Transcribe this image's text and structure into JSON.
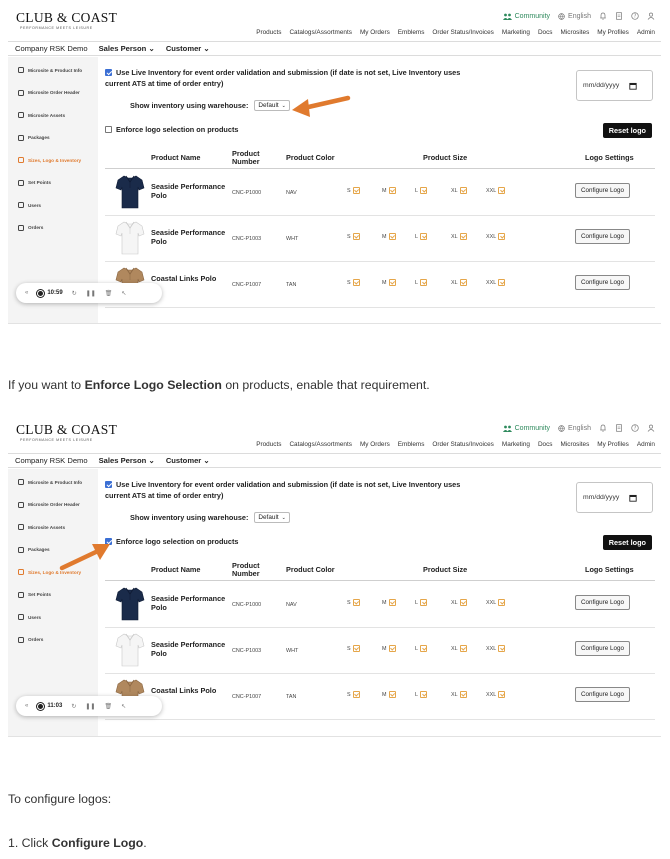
{
  "colors": {
    "accent": "#e07a2e",
    "community": "#2e8a5d",
    "checkbox": "#3b6fd4",
    "size_check": "#e5a64a"
  },
  "header": {
    "brand": "CLUB & COAST",
    "tagline": "PERFORMANCE MEETS LEISURE",
    "community": "Community",
    "language": "English",
    "icons": [
      "community-icon",
      "globe-icon",
      "bell-icon",
      "document-icon",
      "help-icon",
      "user-icon"
    ],
    "nav": [
      "Products",
      "Catalogs/Assortments",
      "My Orders",
      "Emblems",
      "Order Status/Invoices",
      "Marketing",
      "Docs",
      "Microsites",
      "My Profiles",
      "Admin"
    ]
  },
  "context": {
    "company_label": "Company",
    "company_value": "RSK Demo",
    "sales_person": "Sales Person",
    "customer": "Customer"
  },
  "sidebar": [
    {
      "label": "Microsite & Product Info",
      "icon": "info-icon"
    },
    {
      "label": "Microsite Order Header",
      "icon": "list-icon"
    },
    {
      "label": "Microsite Assets",
      "icon": "image-icon"
    },
    {
      "label": "Packages",
      "icon": "package-icon"
    },
    {
      "label": "Sizes, Logo & Inventory",
      "icon": "settings-icon",
      "active": true
    },
    {
      "label": "Set Points",
      "icon": "points-icon"
    },
    {
      "label": "Users",
      "icon": "users-icon"
    },
    {
      "label": "Orders",
      "icon": "orders-icon"
    }
  ],
  "settings": {
    "live_inventory_label": "Use Live Inventory for event order validation and submission (if date is not set, Live Inventory uses current ATS at time of order entry)",
    "warehouse_label": "Show inventory using warehouse:",
    "warehouse_value": "Default",
    "date_placeholder": "mm/dd/yyyy",
    "enforce_label": "Enforce logo selection on products",
    "reset_logo": "Reset logo"
  },
  "table": {
    "headers": {
      "name": "Product Name",
      "number": "Product Number",
      "color": "Product Color",
      "size": "Product Size",
      "logo": "Logo Settings"
    },
    "size_labels": [
      "S",
      "M",
      "L",
      "XL",
      "XXL"
    ],
    "configure_label": "Configure Logo",
    "rows": [
      {
        "name": "Seaside Performance Polo",
        "number": "CNC-P1000",
        "color": "NAV"
      },
      {
        "name": "Seaside Performance Polo",
        "number": "CNC-P1003",
        "color": "WHT"
      },
      {
        "name": "Coastal Links Polo",
        "number": "CNC-P1007",
        "color": "TAN"
      }
    ]
  },
  "screenshots": [
    {
      "recorder_time": "10:59",
      "enforce_checked": false
    },
    {
      "recorder_time": "11:03",
      "enforce_checked": true
    }
  ],
  "captions": {
    "enforce_pre": "If you want to ",
    "enforce_bold": "Enforce Logo Selection",
    "enforce_post": " on products, enable that requirement.",
    "configure_intro": "To configure logos:",
    "step1_pre": "1. Click ",
    "step1_bold": "Configure Logo",
    "step1_post": "."
  }
}
